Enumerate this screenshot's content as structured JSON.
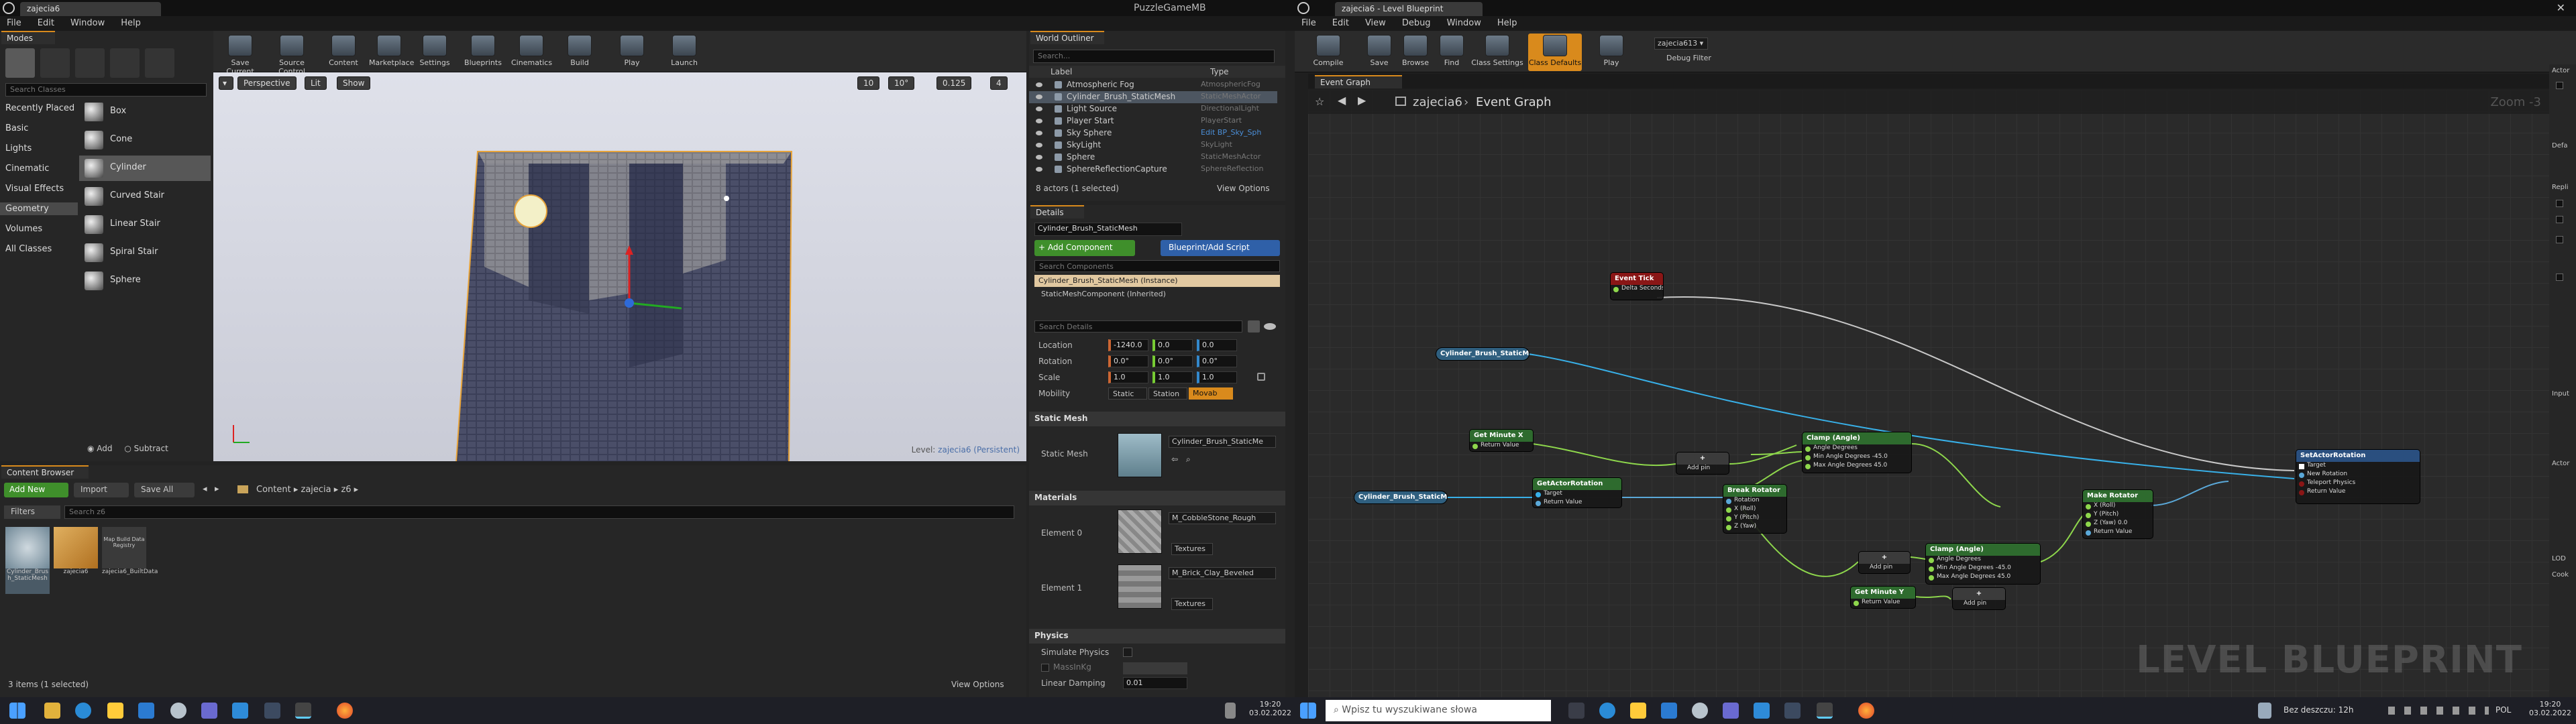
{
  "left_app": {
    "title_tab": "zajecia6",
    "window_title": "PuzzleGameMB",
    "menu": [
      "File",
      "Edit",
      "Window",
      "Help"
    ],
    "modes_tab": "Modes",
    "toolbar": [
      {
        "label": "Save Current",
        "icon": "save-icon"
      },
      {
        "label": "Source Control",
        "icon": "source-control-icon"
      },
      {
        "label": "Content",
        "icon": "content-icon"
      },
      {
        "label": "Marketplace",
        "icon": "marketplace-icon"
      },
      {
        "label": "Settings",
        "icon": "settings-icon"
      },
      {
        "label": "Blueprints",
        "icon": "blueprints-icon"
      },
      {
        "label": "Cinematics",
        "icon": "cinematics-icon"
      },
      {
        "label": "Build",
        "icon": "build-icon"
      },
      {
        "label": "Play",
        "icon": "play-icon"
      },
      {
        "label": "Launch",
        "icon": "launch-icon"
      }
    ],
    "search_classes": "Search Classes",
    "categories": [
      "Recently Placed",
      "Basic",
      "Lights",
      "Cinematic",
      "Visual Effects",
      "Geometry",
      "Volumes",
      "All Classes"
    ],
    "selected_category": "Geometry",
    "place_items": [
      "Box",
      "Cone",
      "Cylinder",
      "Curved Stair",
      "Linear Stair",
      "Spiral Stair",
      "Sphere"
    ],
    "selected_item": "Cylinder",
    "add_label": "Add",
    "subtract_label": "Subtract",
    "viewport": {
      "perspective": "Perspective",
      "lit": "Lit",
      "show": "Show",
      "grid": "10",
      "angle": "10°",
      "scale": "0.125",
      "cam": "4",
      "level_label": "Level:",
      "level_name": "zajecia6 (Persistent)"
    },
    "outliner": {
      "tab": "World Outliner",
      "search": "Search...",
      "col_label": "Label",
      "col_type": "Type",
      "rows": [
        {
          "label": "Atmospheric Fog",
          "type": "AtmosphericFog"
        },
        {
          "label": "Cylinder_Brush_StaticMesh",
          "type": "StaticMeshActor"
        },
        {
          "label": "Light Source",
          "type": "DirectionalLight"
        },
        {
          "label": "Player Start",
          "type": "PlayerStart"
        },
        {
          "label": "Sky Sphere",
          "type": "Edit BP_Sky_Sph"
        },
        {
          "label": "SkyLight",
          "type": "SkyLight"
        },
        {
          "label": "Sphere",
          "type": "StaticMeshActor"
        },
        {
          "label": "SphereReflectionCapture",
          "type": "SphereReflection"
        }
      ],
      "selected": "Cylinder_Brush_StaticMesh",
      "status": "8 actors (1 selected)",
      "view_options": "View Options"
    },
    "details": {
      "tab": "Details",
      "name": "Cylinder_Brush_StaticMesh",
      "add_component": "+ Add Component",
      "blueprint": "Blueprint/Add Script",
      "search": "Search Components",
      "comp1": "Cylinder_Brush_StaticMesh (Instance)",
      "comp2": "StaticMeshComponent (Inherited)",
      "search_details": "Search Details",
      "location_label": "Location",
      "location": [
        "-1240.0",
        "0.0",
        "0.0"
      ],
      "rotation_label": "Rotation",
      "rotation": [
        "0.0°",
        "0.0°",
        "0.0°"
      ],
      "scale_label": "Scale",
      "scale": [
        "1.0",
        "1.0",
        "1.0"
      ],
      "mobility_label": "Mobility",
      "mobility": [
        "Static",
        "Station",
        "Movab"
      ],
      "static_mesh_section": "Static Mesh",
      "static_mesh_label": "Static Mesh",
      "static_mesh_value": "Cylinder_Brush_StaticMe",
      "materials_section": "Materials",
      "element0": "Element 0",
      "mat0": "M_CobbleStone_Rough",
      "element1": "Element 1",
      "mat1": "M_Brick_Clay_Beveled",
      "textures": "Textures",
      "physics_section": "Physics",
      "simulate": "Simulate Physics",
      "mass": "MassInKg",
      "linear_damping": "Linear Damping",
      "linear_damping_value": "0.01"
    },
    "content_browser": {
      "tab": "Content Browser",
      "add_new": "Add New",
      "import": "Import",
      "save_all": "Save All",
      "path": [
        "Content",
        "zajecia",
        "z6"
      ],
      "filters": "Filters",
      "search": "Search z6",
      "assets": [
        {
          "name": "Cylinder_Brush_StaticMesh"
        },
        {
          "name": "zajecia6"
        },
        {
          "name": "zajecia6_BuiltData"
        }
      ],
      "thumb_text": "Map Build Data Registry",
      "status": "3 items (1 selected)",
      "view_options": "View Options"
    }
  },
  "right_app": {
    "title_tab": "zajecia6 - Level Blueprint",
    "menu": [
      "File",
      "Edit",
      "View",
      "Debug",
      "Window",
      "Help"
    ],
    "toolbar": [
      {
        "label": "Compile",
        "icon": "compile-icon"
      },
      {
        "label": "Save",
        "icon": "save-icon"
      },
      {
        "label": "Browse",
        "icon": "browse-icon"
      },
      {
        "label": "Find",
        "icon": "find-icon"
      },
      {
        "label": "Class Settings",
        "icon": "class-settings-icon"
      },
      {
        "label": "Class Defaults",
        "icon": "class-defaults-icon"
      },
      {
        "label": "Play",
        "icon": "play-icon"
      }
    ],
    "debug_object": "zajecia613 ▾",
    "debug_filter": "Debug Filter",
    "graph_tab": "Event Graph",
    "breadcrumb": [
      "zajecia6",
      "Event Graph"
    ],
    "zoom": "Zoom -3",
    "watermark": "LEVEL BLUEPRINT",
    "side_sections": [
      "Actor",
      "Defa",
      "Repli",
      "Input",
      "Actor",
      "LOD",
      "Cook"
    ],
    "nodes": [
      {
        "title": "Event Tick",
        "rows": [
          "Delta Seconds"
        ]
      },
      {
        "title": "Cylinder_Brush_StaticMesh",
        "rows": []
      },
      {
        "title": "Get Minute X",
        "rows": [
          "Return Value"
        ]
      },
      {
        "title": "Clamp (Angle)",
        "rows": [
          "Angle Degrees",
          "Min Angle Degrees -45.0",
          "Max Angle Degrees 45.0"
        ]
      },
      {
        "title": "SetActorRotation",
        "rows": [
          "Target",
          "New Rotation",
          "Teleport Physics",
          "Return Value"
        ]
      },
      {
        "title": "Cylinder_Brush_StaticMesh",
        "rows": []
      },
      {
        "title": "GetActorRotation",
        "rows": [
          "Target",
          "Return Value"
        ]
      },
      {
        "title": "Break Rotator",
        "rows": [
          "Rotation",
          "X (Roll)",
          "Y (Pitch)",
          "Z (Yaw)"
        ]
      },
      {
        "title": "Make Rotator",
        "rows": [
          "X (Roll)",
          "Y (Pitch)",
          "Z (Yaw) 0.0",
          "Return Value"
        ]
      },
      {
        "title": "Clamp (Angle)",
        "rows": [
          "Angle Degrees",
          "Min Angle Degrees -45.0",
          "Max Angle Degrees 45.0"
        ]
      },
      {
        "title": "Get Minute Y",
        "rows": [
          "Return Value"
        ]
      },
      {
        "title": "+",
        "rows": [
          "Add pin"
        ]
      },
      {
        "title": "+",
        "rows": [
          "Add pin"
        ]
      },
      {
        "title": "+",
        "rows": [
          "Add pin"
        ]
      }
    ]
  },
  "taskbar": {
    "search_placeholder": "Wpisz tu wyszukiwane słowa",
    "weather": "Bez deszczu: 12h",
    "lang": "POL",
    "time_left": "19:20",
    "date_left": "03.02.2022",
    "time_right": "19:20",
    "date_right": "03.02.2022"
  },
  "colors": {
    "accent": "#d98a1c",
    "exec": "#ffffff",
    "struct": "#5aa8d8",
    "float": "#8ed74c",
    "object": "#38b0e8"
  }
}
